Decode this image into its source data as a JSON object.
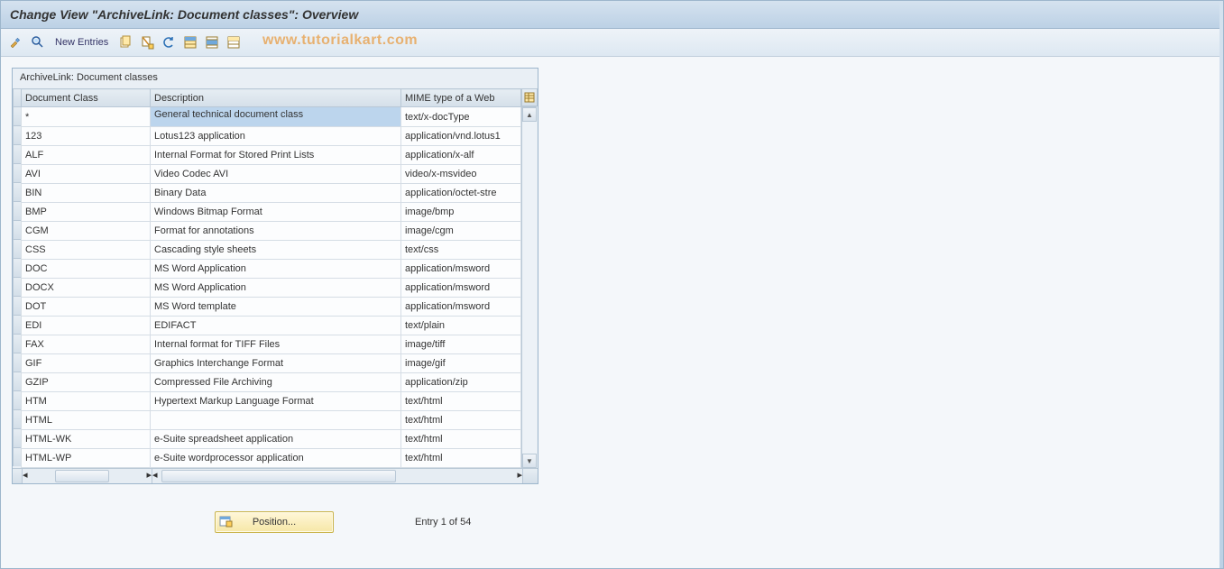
{
  "title": "Change View \"ArchiveLink: Document classes\": Overview",
  "toolbar": {
    "new_entries_label": "New Entries"
  },
  "watermark": "www.tutorialkart.com",
  "panel": {
    "title": "ArchiveLink: Document classes",
    "columns": {
      "doc_class": "Document Class",
      "description": "Description",
      "mime": "MIME type of a Web"
    },
    "rows": [
      {
        "doc_class": "*",
        "description": "General technical document class",
        "mime": "text/x-docType"
      },
      {
        "doc_class": "123",
        "description": "Lotus123 application",
        "mime": "application/vnd.lotus1"
      },
      {
        "doc_class": "ALF",
        "description": "Internal Format for Stored Print Lists",
        "mime": "application/x-alf"
      },
      {
        "doc_class": "AVI",
        "description": "Video Codec AVI",
        "mime": "video/x-msvideo"
      },
      {
        "doc_class": "BIN",
        "description": "Binary Data",
        "mime": "application/octet-stre"
      },
      {
        "doc_class": "BMP",
        "description": "Windows Bitmap Format",
        "mime": "image/bmp"
      },
      {
        "doc_class": "CGM",
        "description": "Format for annotations",
        "mime": "image/cgm"
      },
      {
        "doc_class": "CSS",
        "description": "Cascading style sheets",
        "mime": "text/css"
      },
      {
        "doc_class": "DOC",
        "description": "MS Word Application",
        "mime": "application/msword"
      },
      {
        "doc_class": "DOCX",
        "description": "MS Word Application",
        "mime": "application/msword"
      },
      {
        "doc_class": "DOT",
        "description": "MS Word template",
        "mime": "application/msword"
      },
      {
        "doc_class": "EDI",
        "description": "EDIFACT",
        "mime": "text/plain"
      },
      {
        "doc_class": "FAX",
        "description": "Internal format for TIFF Files",
        "mime": "image/tiff"
      },
      {
        "doc_class": "GIF",
        "description": "Graphics Interchange Format",
        "mime": "image/gif"
      },
      {
        "doc_class": "GZIP",
        "description": "Compressed File Archiving",
        "mime": "application/zip"
      },
      {
        "doc_class": "HTM",
        "description": "Hypertext Markup Language Format",
        "mime": "text/html"
      },
      {
        "doc_class": "HTML",
        "description": "",
        "mime": "text/html"
      },
      {
        "doc_class": "HTML-WK",
        "description": "e-Suite spreadsheet application",
        "mime": "text/html"
      },
      {
        "doc_class": "HTML-WP",
        "description": "e-Suite wordprocessor application",
        "mime": "text/html"
      }
    ]
  },
  "footer": {
    "position_label": "Position...",
    "entry_text": "Entry 1 of 54"
  }
}
